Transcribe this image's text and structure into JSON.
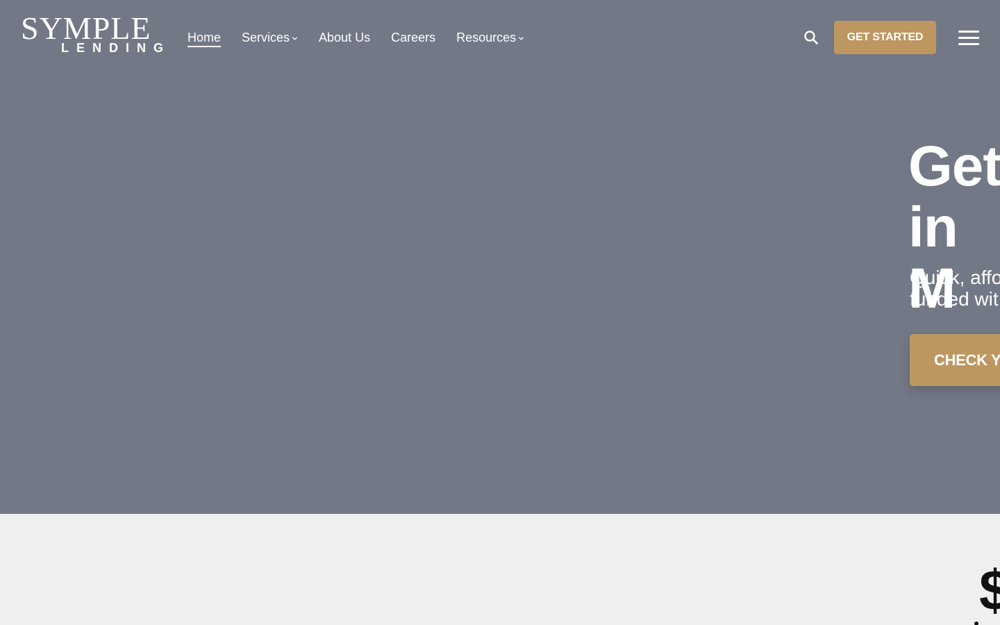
{
  "brand": {
    "logo_main": "SYMPLE",
    "logo_sub": "LENDING"
  },
  "nav": {
    "items": [
      {
        "label": "Home",
        "active": true,
        "dropdown": false
      },
      {
        "label": "Services",
        "active": false,
        "dropdown": true
      },
      {
        "label": "About Us",
        "active": false,
        "dropdown": false
      },
      {
        "label": "Careers",
        "active": false,
        "dropdown": false
      },
      {
        "label": "Resources",
        "active": false,
        "dropdown": true
      }
    ]
  },
  "header": {
    "search_icon": "search-icon",
    "get_started_label": "GET STARTED",
    "menu_icon": "hamburger-menu-icon"
  },
  "hero": {
    "title": "Get\nin M",
    "subtitle": "Quick, affo\nfunded wit",
    "cta_label": "CHECK Y"
  },
  "lower_section": {
    "visible_text": "$"
  },
  "colors": {
    "hero_background": "#737886",
    "accent": "#bd975f",
    "page_background": "#efefef",
    "text_on_dark": "#ffffff"
  }
}
